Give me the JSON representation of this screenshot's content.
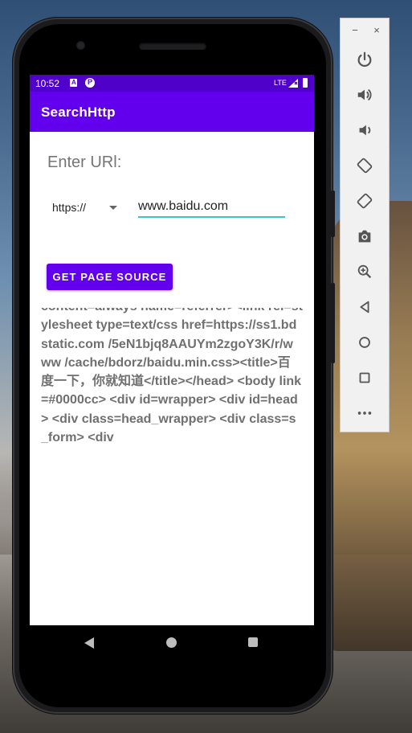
{
  "status_bar": {
    "time": "10:52",
    "network": "LTE"
  },
  "app": {
    "title": "SearchHttp"
  },
  "form": {
    "enter_label": "Enter URl:",
    "protocol_selected": "https://",
    "url_value": "www.baidu.com",
    "button_label": "GET PAGE SOURCE"
  },
  "result": {
    "source_text": "content=always name=referrer><link rel=stylesheet type=text/css href=https://ss1.bdstatic.com /5eN1bjq8AAUYm2zgoY3K/r/www /cache/bdorz/baidu.min.css><title>百度一下，你就知道</title></head> <body link=#0000cc> <div id=wrapper> <div id=head> <div class=head_wrapper> <div class=s_form> <div"
  },
  "emulator_toolbar": {
    "minimize_label": "−",
    "close_label": "×",
    "buttons": [
      {
        "icon": "power-icon"
      },
      {
        "icon": "volume-up-icon"
      },
      {
        "icon": "volume-down-icon"
      },
      {
        "icon": "rotate-left-icon"
      },
      {
        "icon": "rotate-right-icon"
      },
      {
        "icon": "camera-icon"
      },
      {
        "icon": "zoom-icon"
      },
      {
        "icon": "back-icon"
      },
      {
        "icon": "home-icon"
      },
      {
        "icon": "overview-icon"
      },
      {
        "icon": "more-icon"
      }
    ]
  },
  "colors": {
    "primary": "#6200ee",
    "status_bar": "#4f00c9",
    "input_underline": "#3cc8c2",
    "result_text": "#707070"
  }
}
